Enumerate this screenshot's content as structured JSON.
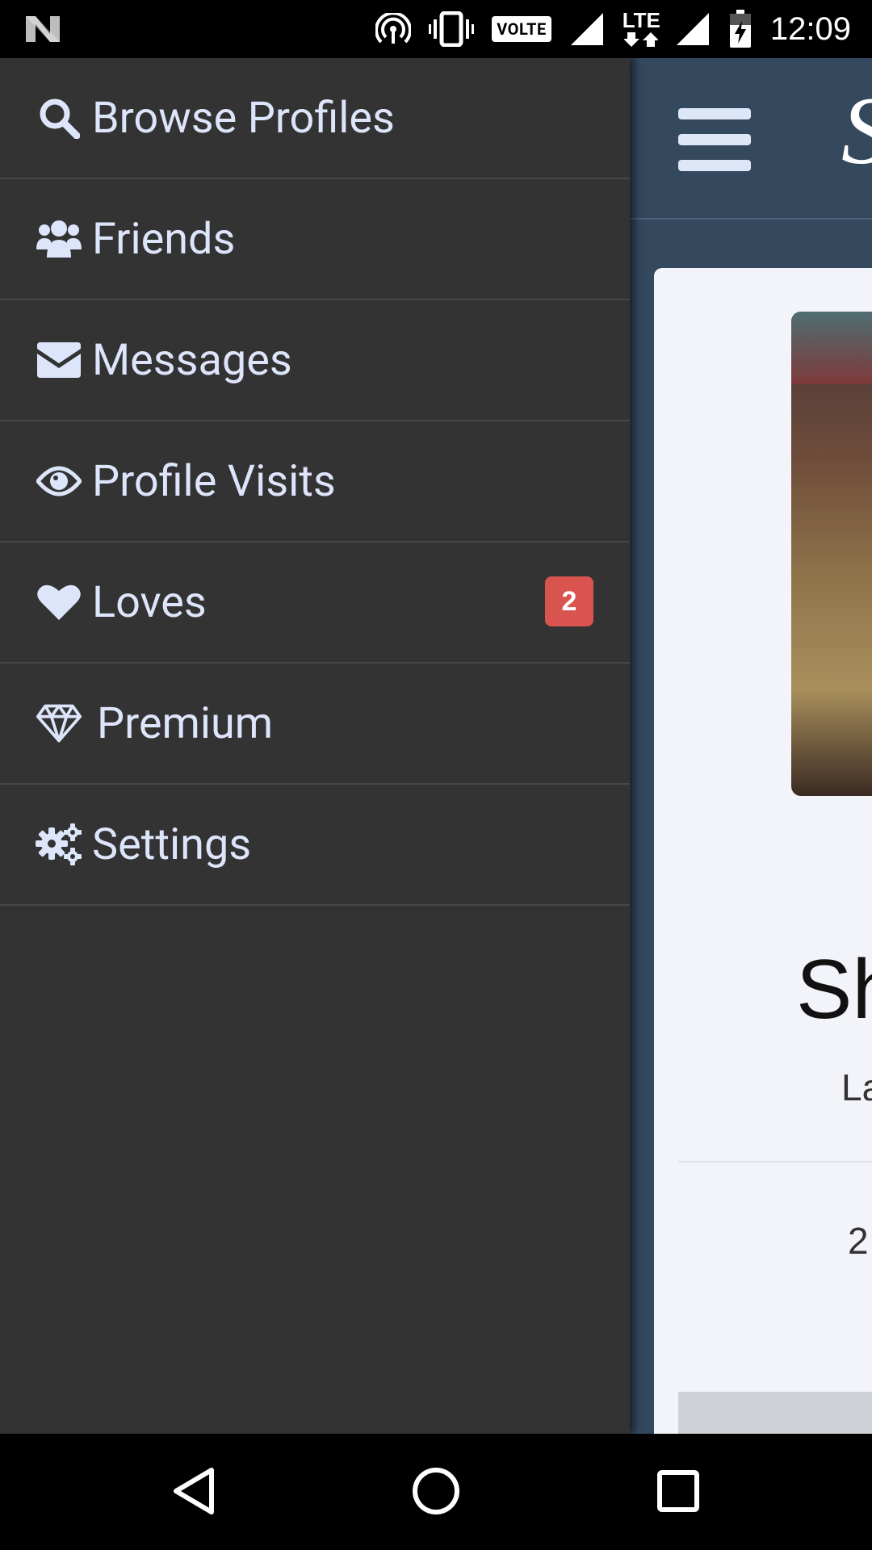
{
  "status_bar": {
    "time": "12:09",
    "volte": "VOLTE",
    "lte": "LTE",
    "icons": [
      "n-logo-icon",
      "hotspot-icon",
      "vibrate-icon",
      "volte-icon",
      "signal-icon",
      "lte-icon",
      "signal-icon",
      "battery-charging-icon"
    ]
  },
  "drawer": {
    "items": [
      {
        "label": "Browse Profiles",
        "icon": "search-icon"
      },
      {
        "label": "Friends",
        "icon": "users-icon"
      },
      {
        "label": "Messages",
        "icon": "envelope-icon"
      },
      {
        "label": "Profile Visits",
        "icon": "eye-icon"
      },
      {
        "label": "Loves",
        "icon": "heart-icon",
        "badge": "2"
      },
      {
        "label": "Premium",
        "icon": "diamond-icon"
      },
      {
        "label": "Settings",
        "icon": "gears-icon"
      }
    ]
  },
  "background_app": {
    "brand_letter": "S",
    "name_partial": "Sh",
    "sub_partial": "La",
    "stat_partial": "2"
  },
  "nav_bar": {
    "icons": [
      "back-icon",
      "home-icon",
      "recents-icon"
    ]
  },
  "colors": {
    "drawer_bg": "#333333",
    "menu_text": "#dde5fb",
    "badge_bg": "#d9534f",
    "app_header_bg": "#34495e"
  }
}
